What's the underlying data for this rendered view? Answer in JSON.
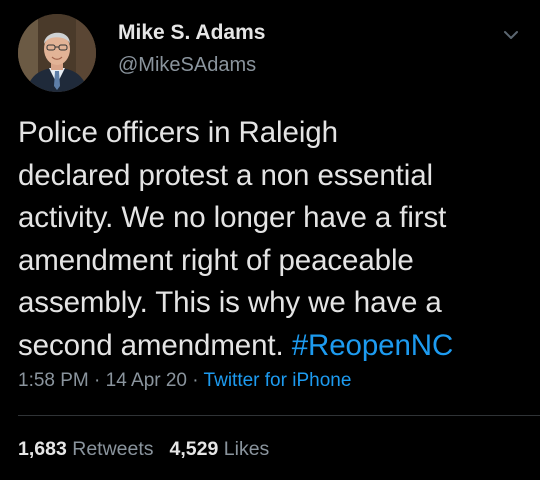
{
  "author": {
    "display_name": "Mike S. Adams",
    "handle": "@MikeSAdams"
  },
  "icons": {
    "avatar": "profile-photo",
    "menu": "chevron-down-icon"
  },
  "tweet": {
    "lines": [
      "Police officers in Raleigh",
      "declared protest a non essential",
      "activity. We no longer have a first",
      "amendment right of peaceable",
      "assembly. This is why we have a",
      "second amendment. "
    ],
    "hashtag": "#ReopenNC"
  },
  "meta": {
    "time": "1:58 PM",
    "separator1": " · ",
    "date": "14 Apr 20",
    "separator2": " · ",
    "source": "Twitter for iPhone"
  },
  "stats": {
    "retweets_count": "1,683",
    "retweets_label": "Retweets",
    "likes_count": "4,529",
    "likes_label": "Likes"
  },
  "colors": {
    "background": "#000000",
    "text": "#e4e4e4",
    "secondary": "#8a949d",
    "link": "#1d9bf0"
  }
}
